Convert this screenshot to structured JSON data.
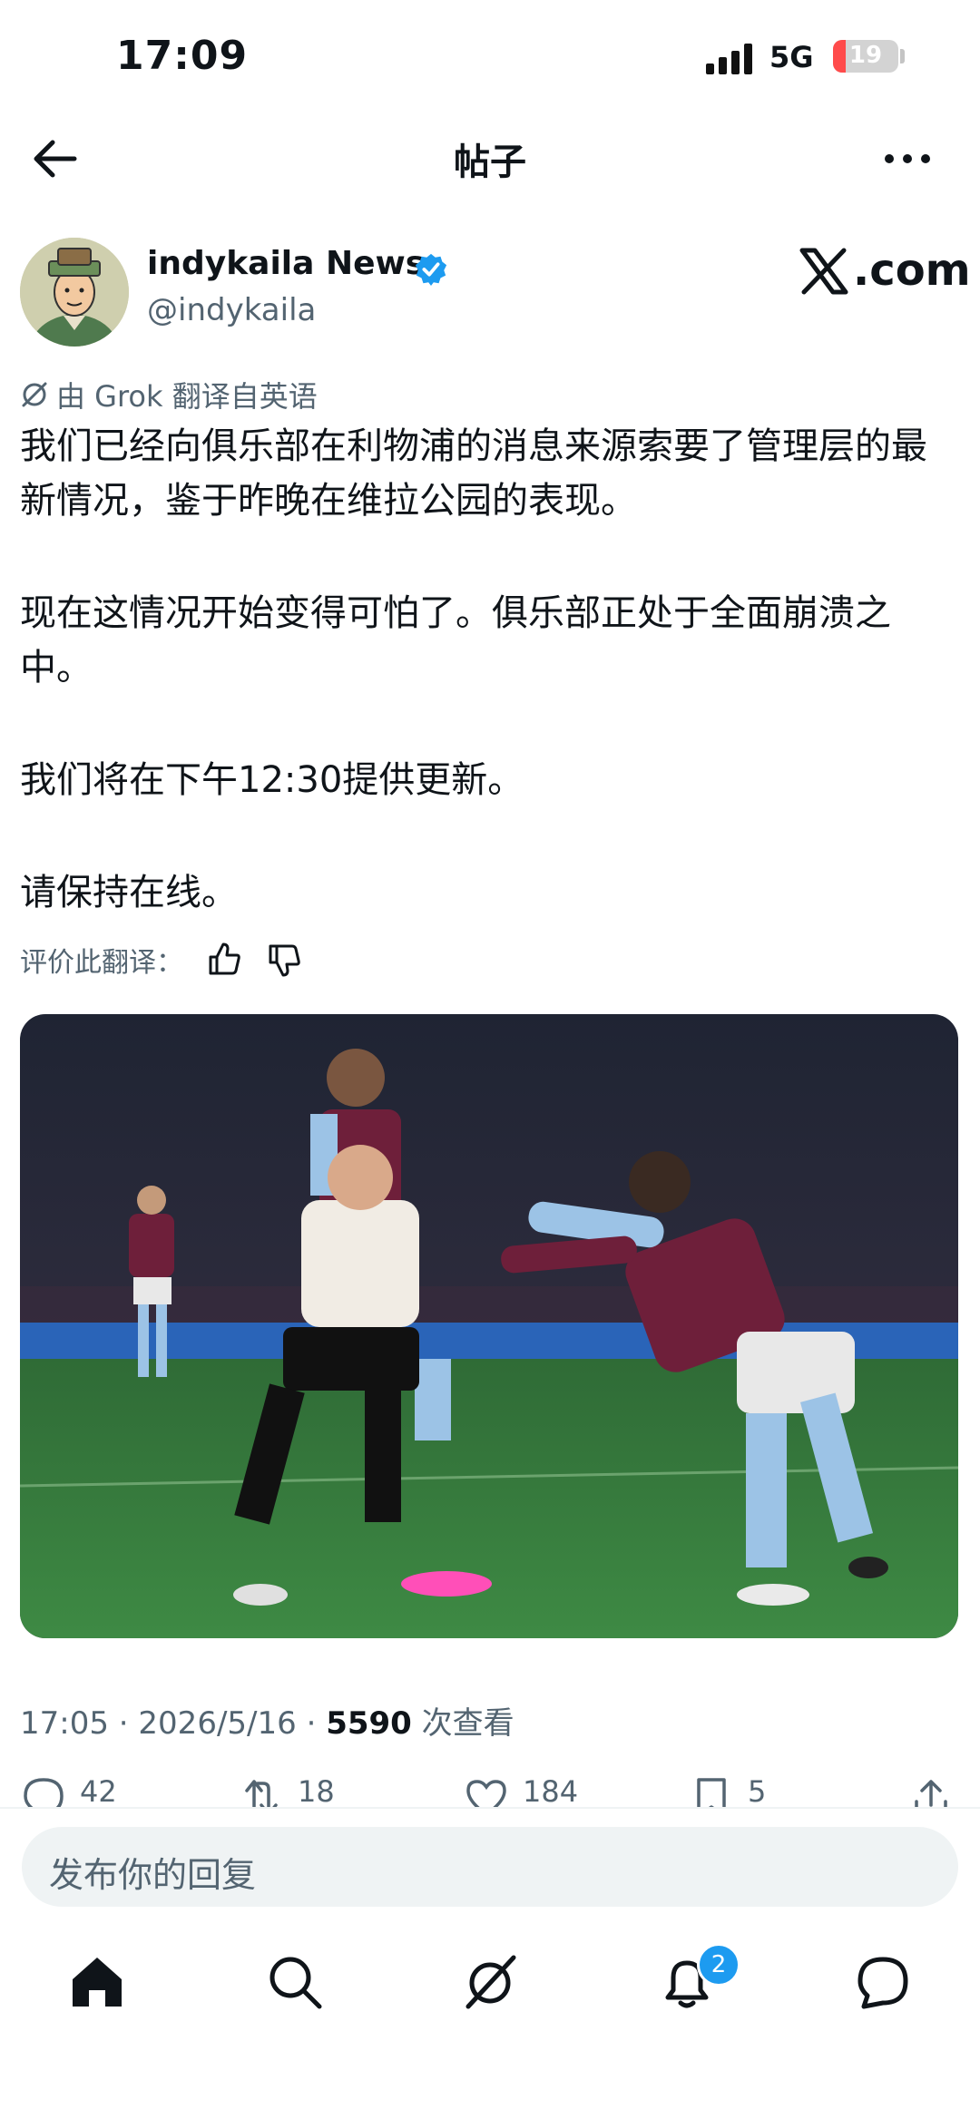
{
  "status_bar": {
    "time": "17:09",
    "network": "5G",
    "battery": "19"
  },
  "header": {
    "title": "帖子"
  },
  "post": {
    "author_name": "indykaila News",
    "author_handle": "@indykaila",
    "source_label": ".com",
    "translation_note": "由 Grok 翻译自英语",
    "paragraphs": [
      "我们已经向俱乐部在利物浦的消息来源索要了管理层的最新情况，鉴于昨晚在维拉公园的表现。",
      "现在这情况开始变得可怕了。俱乐部正处于全面崩溃之中。",
      "我们将在下午12:30提供更新。",
      "请保持在线。"
    ],
    "rate_label": "评价此翻译：",
    "time": "17:05",
    "date": "2026/5/16",
    "views_count": "5590",
    "views_label": "次查看",
    "sep": "·"
  },
  "actions": {
    "replies": "42",
    "reposts": "18",
    "likes": "184",
    "bookmarks": "5"
  },
  "reply_bar": {
    "placeholder": "发布你的回复"
  },
  "tabbar": {
    "notifications_badge": "2"
  },
  "colors": {
    "accent": "#1d9bf0",
    "muted": "#536471",
    "text": "#0f1419"
  }
}
